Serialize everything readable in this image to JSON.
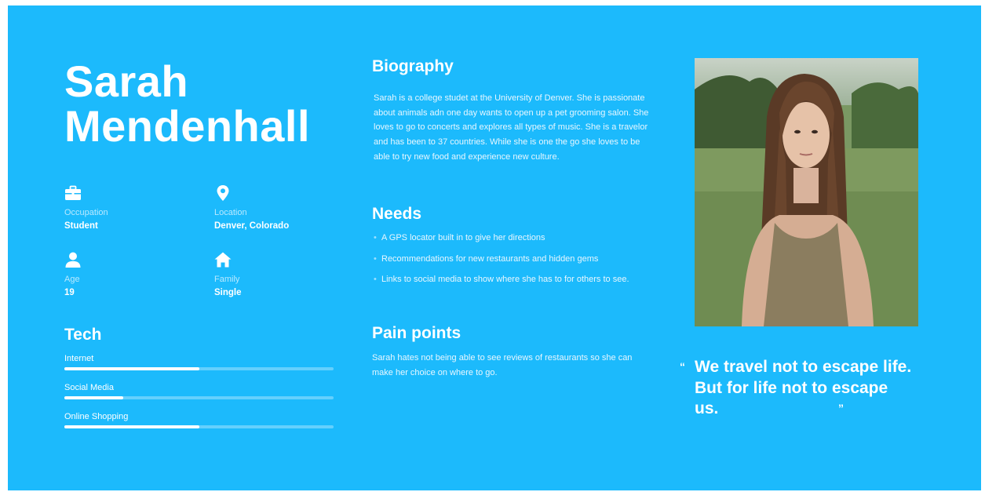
{
  "persona": {
    "first_name": "Sarah",
    "last_name": "Mendenhall"
  },
  "attributes": {
    "occupation": {
      "label": "Occupation",
      "value": "Student",
      "icon": "briefcase-icon"
    },
    "location": {
      "label": "Location",
      "value": "Denver, Colorado",
      "icon": "location-pin-icon"
    },
    "age": {
      "label": "Age",
      "value": "19",
      "icon": "person-icon"
    },
    "family": {
      "label": "Family",
      "value": "Single",
      "icon": "home-icon"
    }
  },
  "tech": {
    "heading": "Tech",
    "items": [
      {
        "label": "Internet",
        "level": 0.5
      },
      {
        "label": "Social Media",
        "level": 0.22
      },
      {
        "label": "Online Shopping",
        "level": 0.5
      }
    ]
  },
  "biography": {
    "heading": "Biography",
    "text": "Sarah is a college studet at the University of Denver. She is passionate about animals adn one day wants to open up a pet grooming salon. She loves to go to concerts and explores all types of music. She is a travelor and has been to 37 countries. While she is one the go she loves to be able to try new food and experience new culture."
  },
  "needs": {
    "heading": "Needs",
    "items": [
      "A GPS locator built in to give her directions",
      "Recommendations  for new restaurants and hidden gems",
      "Links to social media to show where she has to for others to see."
    ]
  },
  "pain_points": {
    "heading": "Pain points",
    "text": "Sarah hates not being able to see reviews of restaurants so she can make her choice on where to go."
  },
  "quote": {
    "open": "“",
    "text": "We travel not to escape life. But for life not to escape us.",
    "close": "”"
  },
  "colors": {
    "background": "#1cbafc",
    "text": "#ffffff",
    "track": "rgba(255,255,255,0.32)"
  }
}
